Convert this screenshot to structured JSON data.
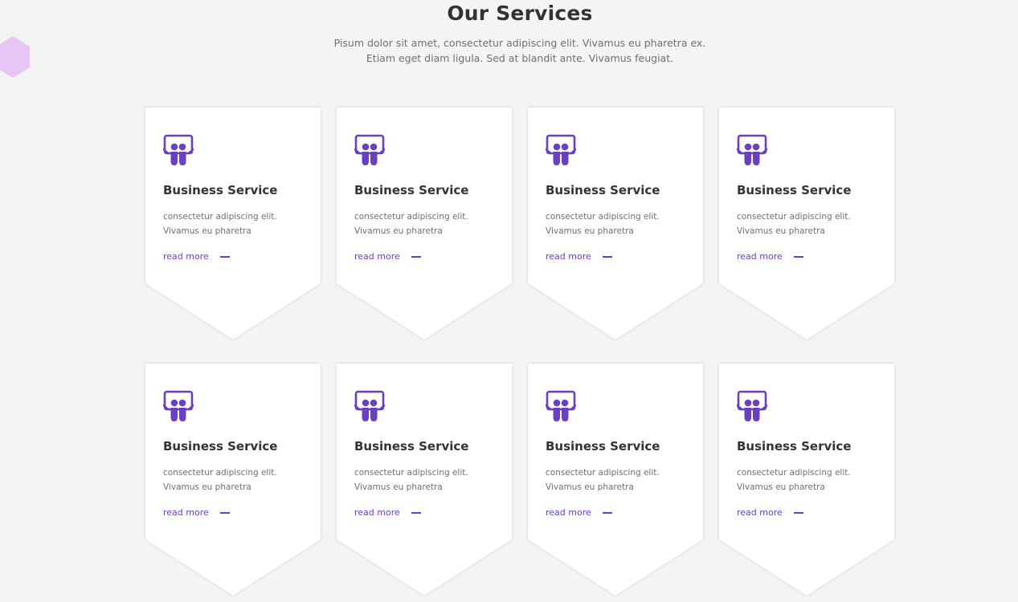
{
  "header": {
    "title": "Our Services",
    "subtitle_line1": "Pisum dolor sit amet, consectetur adipiscing elit. Vivamus eu pharetra ex.",
    "subtitle_line2": "Etiam eget diam ligula. Sed at blandit ante. Vivamus feugiat."
  },
  "colors": {
    "accent": "#6b3fc2",
    "background": "#f4f4f4",
    "card": "#ffffff",
    "decoration": "#e6c6f7"
  },
  "cards": [
    {
      "icon": "slideshare-icon",
      "title": "Business Service",
      "text_line1": "consectetur adipiscing elit.",
      "text_line2": "Vivamus eu pharetra",
      "link": "read more"
    },
    {
      "icon": "slideshare-icon",
      "title": "Business Service",
      "text_line1": "consectetur adipiscing elit.",
      "text_line2": "Vivamus eu pharetra",
      "link": "read more"
    },
    {
      "icon": "slideshare-icon",
      "title": "Business Service",
      "text_line1": "consectetur adipiscing elit.",
      "text_line2": "Vivamus eu pharetra",
      "link": "read more"
    },
    {
      "icon": "slideshare-icon",
      "title": "Business Service",
      "text_line1": "consectetur adipiscing elit.",
      "text_line2": "Vivamus eu pharetra",
      "link": "read more"
    },
    {
      "icon": "slideshare-icon",
      "title": "Business Service",
      "text_line1": "consectetur adipiscing elit.",
      "text_line2": "Vivamus eu pharetra",
      "link": "read more"
    },
    {
      "icon": "slideshare-icon",
      "title": "Business Service",
      "text_line1": "consectetur adipiscing elit.",
      "text_line2": "Vivamus eu pharetra",
      "link": "read more"
    },
    {
      "icon": "slideshare-icon",
      "title": "Business Service",
      "text_line1": "consectetur adipiscing elit.",
      "text_line2": "Vivamus eu pharetra",
      "link": "read more"
    },
    {
      "icon": "slideshare-icon",
      "title": "Business Service",
      "text_line1": "consectetur adipiscing elit.",
      "text_line2": "Vivamus eu pharetra",
      "link": "read more"
    }
  ]
}
